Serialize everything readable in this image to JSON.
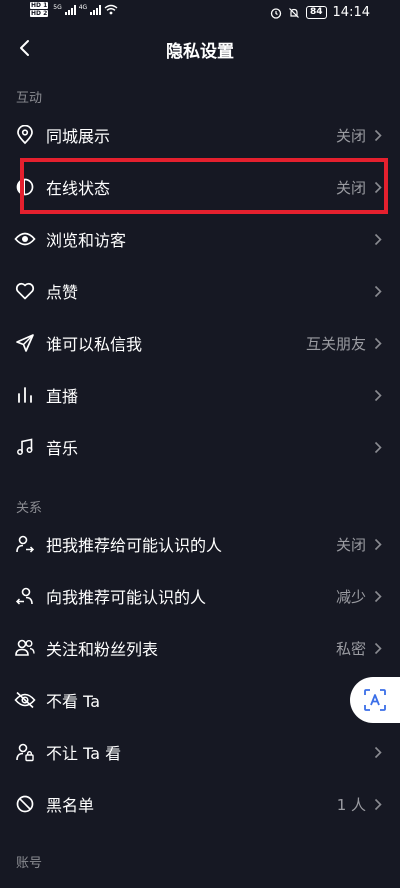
{
  "status_bar": {
    "sim1": "HD 1",
    "sim2": "HD 2",
    "net1": "5G",
    "net2": "4G",
    "battery": "84",
    "time": "14:14"
  },
  "header": {
    "title": "隐私设置"
  },
  "sections": {
    "interaction": {
      "label": "互动",
      "items": [
        {
          "label": "同城展示",
          "value": "关闭",
          "icon": "location-pin-icon"
        },
        {
          "label": "在线状态",
          "value": "关闭",
          "icon": "online-status-icon"
        },
        {
          "label": "浏览和访客",
          "value": "",
          "icon": "eye-icon"
        },
        {
          "label": "点赞",
          "value": "",
          "icon": "heart-icon"
        },
        {
          "label": "谁可以私信我",
          "value": "互关朋友",
          "icon": "paper-plane-icon"
        },
        {
          "label": "直播",
          "value": "",
          "icon": "live-bars-icon"
        },
        {
          "label": "音乐",
          "value": "",
          "icon": "music-note-icon"
        }
      ]
    },
    "relations": {
      "label": "关系",
      "items": [
        {
          "label": "把我推荐给可能认识的人",
          "value": "关闭",
          "icon": "user-share-icon"
        },
        {
          "label": "向我推荐可能认识的人",
          "value": "减少",
          "icon": "user-recommend-icon"
        },
        {
          "label": "关注和粉丝列表",
          "value": "私密",
          "icon": "users-icon"
        },
        {
          "label": "不看 Ta",
          "value": "",
          "icon": "eye-off-icon"
        },
        {
          "label": "不让 Ta 看",
          "value": "",
          "icon": "user-lock-icon"
        },
        {
          "label": "黑名单",
          "value": "1 人",
          "icon": "block-icon"
        }
      ]
    },
    "account": {
      "label": "账号"
    }
  },
  "colors": {
    "background": "#161823",
    "highlight": "#e4202e",
    "secondary_text": "#9a9ba1"
  }
}
